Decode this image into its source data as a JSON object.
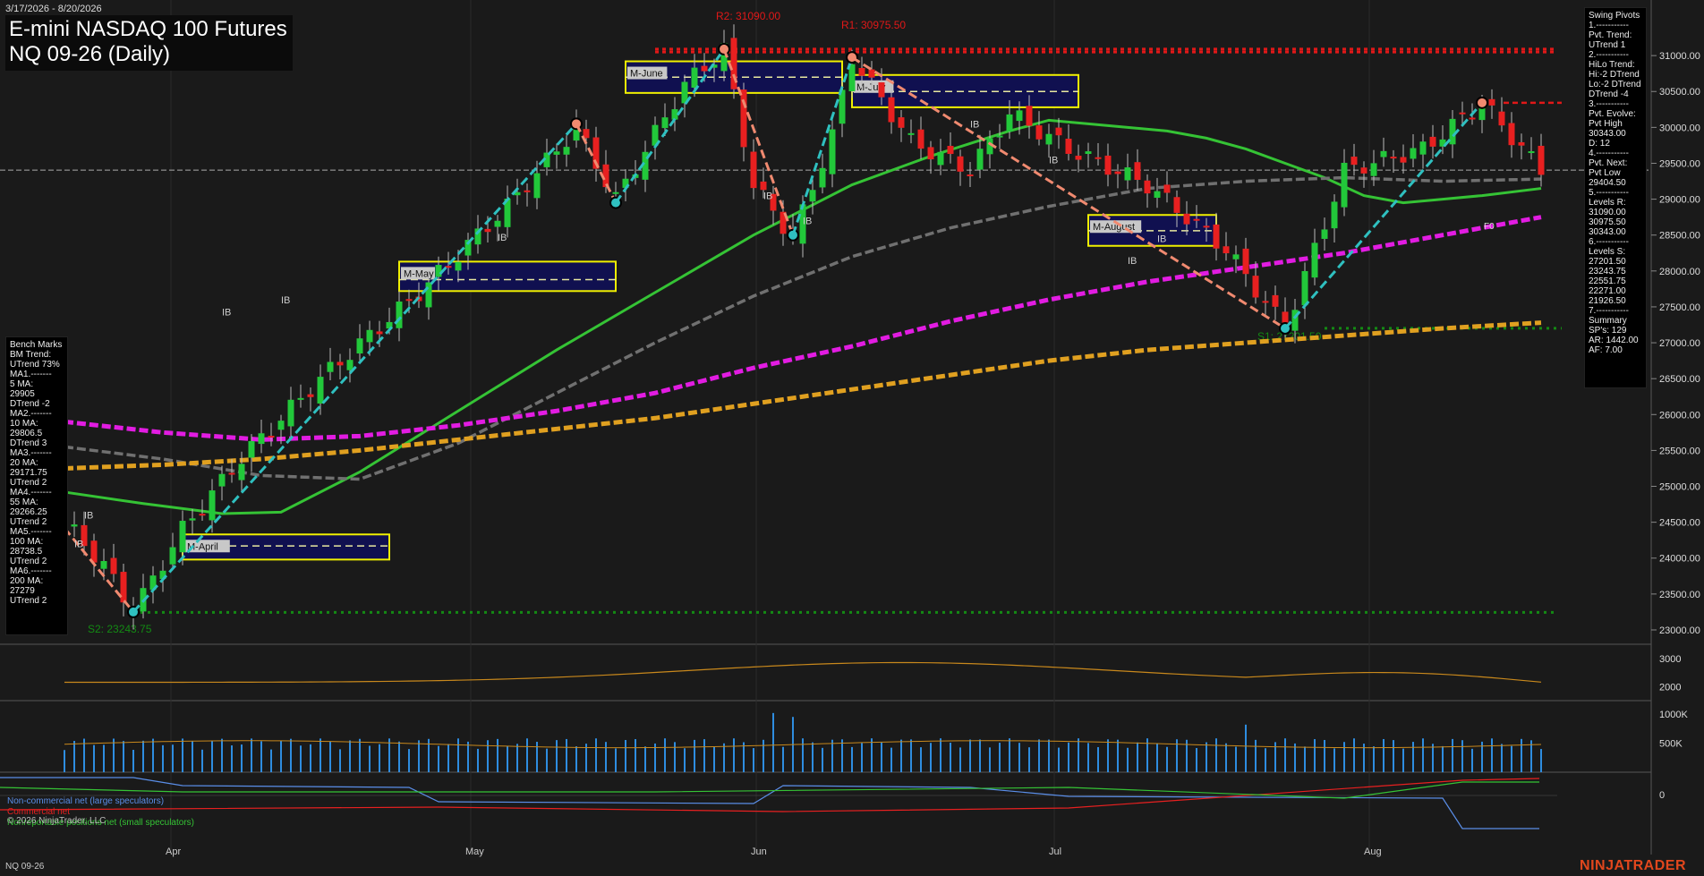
{
  "header": {
    "title_line1": "E-mini NASDAQ 100 Futures",
    "title_line2": "NQ 09-26 (Daily)",
    "date_range": "3/17/2026 - 8/20/2026"
  },
  "footer": {
    "symbol": "NQ 09-26",
    "brand": "NINJATRADER",
    "copyright": "© 2026 NinjaTrader, LLC"
  },
  "colors": {
    "background": "#1a1a1a",
    "up_candle": "#22c83a",
    "down_candle": "#e82020",
    "ma_green": "#35c335",
    "ma_gray": "#707070",
    "ma_magenta": "#e21ce2",
    "ma_orange": "#e0a020",
    "trend_cyan": "#2fc0c0",
    "trend_salmon": "#f08a70",
    "resistance": "#e01818",
    "support": "#138a13",
    "volume": "#2e8de0",
    "vp_box_fill": "#101050",
    "vp_box_border": "#f0f000"
  },
  "benchmarks_panel": {
    "lines": [
      "Bench Marks",
      "BM Trend:",
      "UTrend 73%",
      "MA1.-------",
      "5 MA:",
      "29905",
      "DTrend -2",
      "MA2.-------",
      "10 MA:",
      "29806.5",
      "DTrend 3",
      "MA3.-------",
      "20 MA:",
      "29171.75",
      "UTrend 2",
      "MA4.-------",
      "55 MA:",
      "29266.25",
      "UTrend 2",
      "MA5.-------",
      "100 MA:",
      "28738.5",
      "UTrend 2",
      "MA6.-------",
      "200 MA:",
      "27279",
      "UTrend 2"
    ]
  },
  "swing_panel": {
    "lines": [
      "Swing Pivots",
      "1.-----------",
      "Pvt. Trend:",
      "UTrend 1",
      "2.-----------",
      "HiLo Trend:",
      "Hi:-2 DTrend",
      "Lo:-2 DTrend",
      "DTrend -4",
      "3.-----------",
      "Pvt. Evolve:",
      "Pvt High",
      "30343.00",
      "D: 12",
      "4.-----------",
      "Pvt. Next:",
      "Pvt Low",
      "29404.50",
      "5.-----------",
      "Levels R:",
      "31090.00",
      "30975.50",
      "30343.00",
      "6.-----------",
      "Levels S:",
      "27201.50",
      "23243.75",
      "22551.75",
      "22271.00",
      "21926.50",
      "7.-----------",
      "Summary",
      "SP's: 129",
      "AR: 1442.00",
      "AF: 7.00"
    ]
  },
  "cot_legend": {
    "noncommercial": "Non-commercial net (large speculators)",
    "commercial": "Commercial net",
    "nonreportable": "Nonreportable positions net (small speculators)"
  },
  "chart_data": {
    "type": "candlestick",
    "x_months": [
      "Apr",
      "May",
      "Jun",
      "Jul",
      "Aug"
    ],
    "price_axis": {
      "ticks": [
        23000,
        23500,
        24000,
        24500,
        25000,
        25500,
        26000,
        26500,
        27000,
        27500,
        28000,
        28500,
        29000,
        29500,
        30000,
        30500,
        31000
      ],
      "ylim": [
        22900,
        31550
      ]
    },
    "annotations": {
      "r2_label": "R2: 31090.00",
      "r1_label": "R1: 30975.50",
      "s2_label": "S2: 23243.75",
      "s1_label": "S1: 27201.50",
      "ib": "IB",
      "f0": "F0"
    },
    "levels": {
      "R2": 31090.0,
      "R1": 30975.5,
      "pivot_high": 30343.0,
      "S1": 27201.5,
      "S2": 23243.75,
      "last_price": 29405
    },
    "moving_averages": [
      {
        "name": "MA20",
        "color": "#35c335",
        "points": [
          [
            0,
            24920
          ],
          [
            8,
            24760
          ],
          [
            16,
            24620
          ],
          [
            22,
            24640
          ],
          [
            30,
            25200
          ],
          [
            40,
            26050
          ],
          [
            50,
            26900
          ],
          [
            60,
            27700
          ],
          [
            70,
            28500
          ],
          [
            80,
            29200
          ],
          [
            88,
            29600
          ],
          [
            96,
            29950
          ],
          [
            100,
            30100
          ],
          [
            104,
            30050
          ],
          [
            108,
            30000
          ],
          [
            112,
            29950
          ],
          [
            116,
            29850
          ],
          [
            120,
            29700
          ],
          [
            124,
            29500
          ],
          [
            128,
            29300
          ],
          [
            132,
            29050
          ],
          [
            136,
            28950
          ],
          [
            140,
            29000
          ],
          [
            144,
            29050
          ],
          [
            150,
            29150
          ]
        ]
      },
      {
        "name": "MA55",
        "color": "#707070",
        "points": [
          [
            0,
            25550
          ],
          [
            10,
            25380
          ],
          [
            20,
            25150
          ],
          [
            30,
            25100
          ],
          [
            40,
            25600
          ],
          [
            50,
            26300
          ],
          [
            60,
            27000
          ],
          [
            70,
            27650
          ],
          [
            80,
            28200
          ],
          [
            90,
            28600
          ],
          [
            100,
            28900
          ],
          [
            110,
            29150
          ],
          [
            120,
            29250
          ],
          [
            130,
            29300
          ],
          [
            140,
            29250
          ],
          [
            150,
            29280
          ]
        ]
      },
      {
        "name": "MA100",
        "color": "#e21ce2",
        "points": [
          [
            0,
            25900
          ],
          [
            10,
            25750
          ],
          [
            20,
            25650
          ],
          [
            30,
            25700
          ],
          [
            40,
            25850
          ],
          [
            50,
            26050
          ],
          [
            60,
            26300
          ],
          [
            70,
            26650
          ],
          [
            80,
            26950
          ],
          [
            90,
            27300
          ],
          [
            100,
            27600
          ],
          [
            110,
            27850
          ],
          [
            120,
            28050
          ],
          [
            130,
            28250
          ],
          [
            140,
            28500
          ],
          [
            150,
            28750
          ]
        ]
      },
      {
        "name": "MA200",
        "color": "#e0a020",
        "points": [
          [
            0,
            25250
          ],
          [
            10,
            25300
          ],
          [
            20,
            25380
          ],
          [
            30,
            25500
          ],
          [
            40,
            25650
          ],
          [
            50,
            25800
          ],
          [
            60,
            25950
          ],
          [
            70,
            26150
          ],
          [
            80,
            26350
          ],
          [
            90,
            26550
          ],
          [
            100,
            26750
          ],
          [
            110,
            26900
          ],
          [
            120,
            27000
          ],
          [
            130,
            27100
          ],
          [
            140,
            27200
          ],
          [
            150,
            27280
          ]
        ]
      }
    ],
    "volume_axis": {
      "ticks": [
        "1000K",
        "500K"
      ]
    },
    "atr_axis": {
      "ticks": [
        3000,
        2000
      ]
    },
    "cot_axis": {
      "ticks": [
        0
      ]
    },
    "volume_profile_boxes": [
      {
        "label": "M-April",
        "x0": 12,
        "x1": 33,
        "top": 24330,
        "bottom": 23980,
        "poc": 24170
      },
      {
        "label": "M-May",
        "x0": 34,
        "x1": 56,
        "top": 28130,
        "bottom": 27720,
        "poc": 27880
      },
      {
        "label": "M-June",
        "x0": 57,
        "x1": 79,
        "top": 30920,
        "bottom": 30480,
        "poc": 30700
      },
      {
        "label": "M-July",
        "x0": 80,
        "x1": 103,
        "top": 30730,
        "bottom": 30280,
        "poc": 30500
      },
      {
        "label": "M-August",
        "x0": 104,
        "x1": 117,
        "top": 28780,
        "bottom": 28350,
        "poc": 28560
      }
    ]
  }
}
